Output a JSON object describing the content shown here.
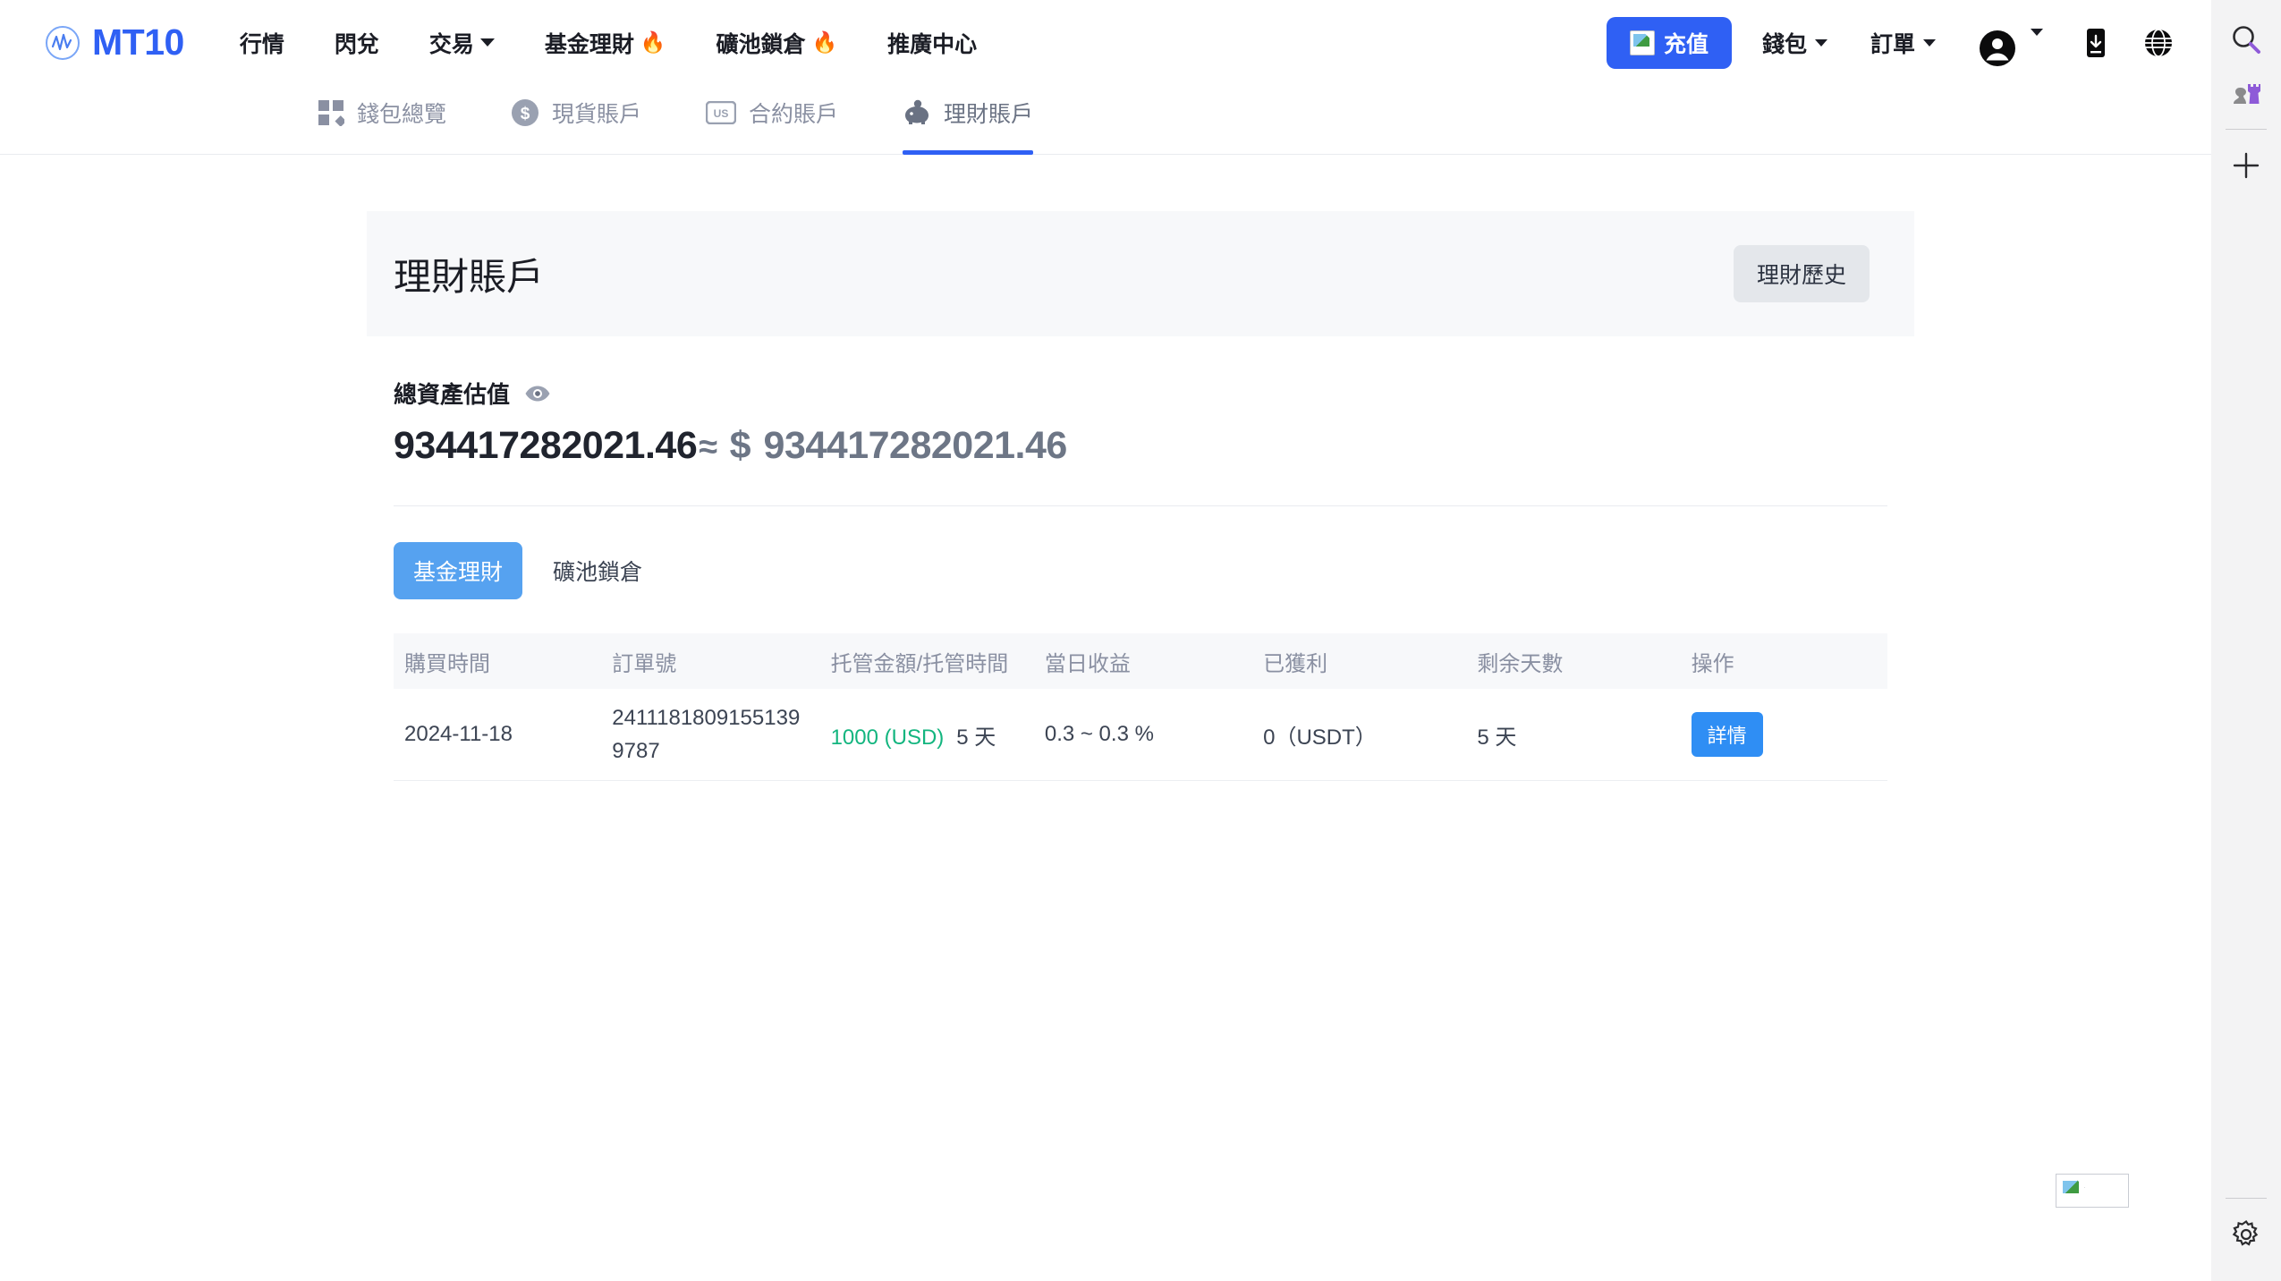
{
  "brand": {
    "name": "MT10",
    "logo_icon": "wave-logo-icon",
    "color": "#2f60f4"
  },
  "topnav": {
    "items": [
      {
        "label": "行情",
        "icon": null,
        "caret": false,
        "flame": false
      },
      {
        "label": "閃兌",
        "icon": null,
        "caret": false,
        "flame": false
      },
      {
        "label": "交易",
        "icon": "chevron-down-icon",
        "caret": true,
        "flame": false
      },
      {
        "label": "基金理財",
        "icon": "fire-icon",
        "caret": false,
        "flame": true
      },
      {
        "label": "礦池鎖倉",
        "icon": "fire-icon",
        "caret": false,
        "flame": true
      },
      {
        "label": "推廣中心",
        "icon": null,
        "caret": false,
        "flame": false
      }
    ],
    "flame_glyph": "🔥",
    "deposit": {
      "label": "充值",
      "icon": "broken-image-icon"
    },
    "wallet": {
      "label": "錢包",
      "icon": "chevron-down-icon"
    },
    "orders": {
      "label": "訂單",
      "icon": "chevron-down-icon"
    },
    "account": {
      "icon": "user-avatar-icon",
      "caret_icon": "chevron-down-icon"
    },
    "download_icon": "download-icon",
    "language_icon": "globe-icon"
  },
  "account_tabs": [
    {
      "label": "錢包總覽",
      "icon": "grid-squares-icon",
      "active": false
    },
    {
      "label": "現貨賬戶",
      "icon": "dollar-circle-icon",
      "active": false
    },
    {
      "label": "合約賬戶",
      "icon": "us-badge-icon",
      "active": false
    },
    {
      "label": "理財賬戶",
      "icon": "piggy-bank-icon",
      "active": true
    }
  ],
  "panel": {
    "title": "理財賬戶",
    "history_button": "理財歷史"
  },
  "assets": {
    "label": "總資產估值",
    "eye_icon": "eye-icon",
    "primary_value": "934417282021.46",
    "approx_symbol": "≈",
    "currency_symbol": "$",
    "secondary_value": "934417282021.46"
  },
  "subtabs": [
    {
      "label": "基金理財",
      "active": true
    },
    {
      "label": "礦池鎖倉",
      "active": false
    }
  ],
  "table": {
    "headers": [
      "購買時間",
      "訂單號",
      "托管金額/托管時間",
      "當日收益",
      "已獲利",
      "剩余天數",
      "操作"
    ],
    "rows": [
      {
        "purchase_time": "2024-11-18",
        "order_no": "24111818091551399787",
        "amount": "1000 (USD)",
        "custody_days": "5 天",
        "daily_yield": "0.3 ~ 0.3 %",
        "profit": "0（USDT）",
        "days_left": "5 天",
        "action_label": "詳情"
      }
    ]
  },
  "browser_rail": {
    "search_icon": "search-icon",
    "chess_icon": "chess-pieces-icon",
    "add_icon": "plus-icon",
    "settings_icon": "gear-icon"
  },
  "page_artifacts": {
    "broken_image_icon": "broken-image-icon"
  },
  "colors": {
    "brand_blue": "#2f60f4",
    "tab_blue": "#56a2f0",
    "button_blue": "#2f8ef4",
    "green": "#13b57f",
    "panel_gray": "#f7f8fa",
    "muted": "#8a90a2"
  }
}
